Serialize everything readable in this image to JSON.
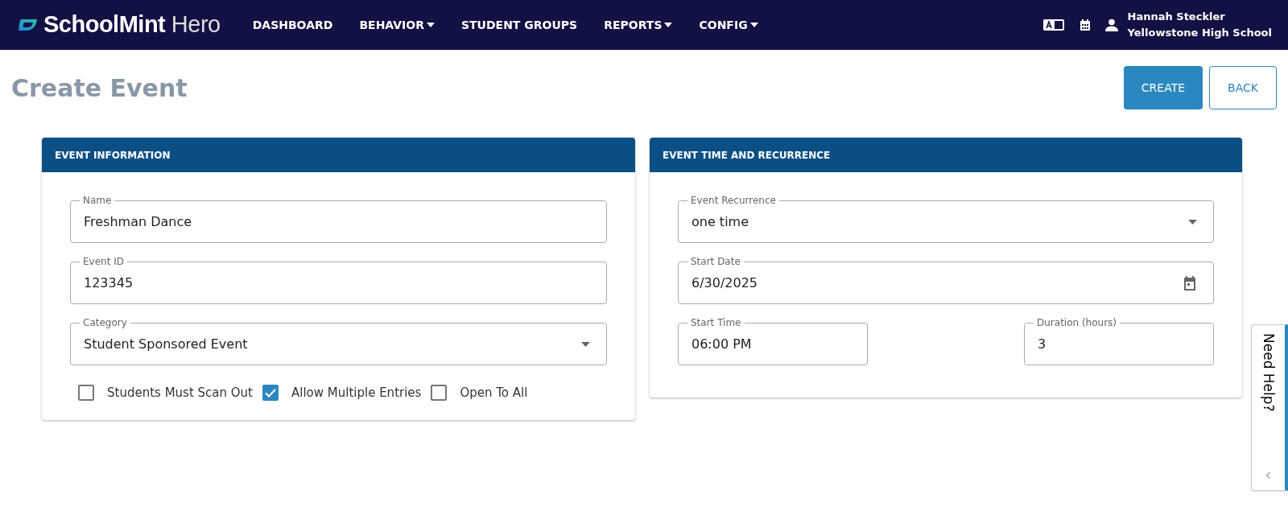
{
  "header": {
    "logo": {
      "brand": "SchoolMint",
      "product": "Hero"
    },
    "nav": [
      {
        "label": "DASHBOARD",
        "dropdown": false
      },
      {
        "label": "BEHAVIOR",
        "dropdown": true
      },
      {
        "label": "STUDENT GROUPS",
        "dropdown": false
      },
      {
        "label": "REPORTS",
        "dropdown": true
      },
      {
        "label": "CONFIG",
        "dropdown": true
      }
    ],
    "user": {
      "name": "Hannah Steckler",
      "school": "Yellowstone High School"
    }
  },
  "page": {
    "title": "Create Event",
    "buttons": [
      {
        "label": "CREATE",
        "kind": "primary"
      },
      {
        "label": "BACK",
        "kind": "outline"
      }
    ]
  },
  "event_information": {
    "title": "EVENT INFORMATION",
    "fields": [
      {
        "label": "Name",
        "value": "Freshman Dance",
        "kind": "text"
      },
      {
        "label": "Event ID",
        "value": "123345",
        "kind": "text"
      },
      {
        "label": "Category",
        "value": "Student Sponsored Event",
        "kind": "select"
      }
    ],
    "checkboxes": [
      {
        "label": "Students Must Scan Out",
        "checked": false
      },
      {
        "label": "Allow Multiple Entries",
        "checked": true
      },
      {
        "label": "Open To All",
        "checked": false
      }
    ]
  },
  "event_time": {
    "title": "EVENT TIME AND RECURRENCE",
    "fields": [
      {
        "label": "Event Recurrence",
        "value": "one time",
        "kind": "select"
      },
      {
        "label": "Start Date",
        "value": "6/30/2025",
        "kind": "date"
      }
    ],
    "start_time": {
      "label": "Start Time",
      "value": "06:00 PM"
    },
    "duration": {
      "label": "Duration (hours)",
      "value": "3"
    }
  },
  "help_tab": {
    "label": "Need Help?",
    "chevron": "‹"
  }
}
